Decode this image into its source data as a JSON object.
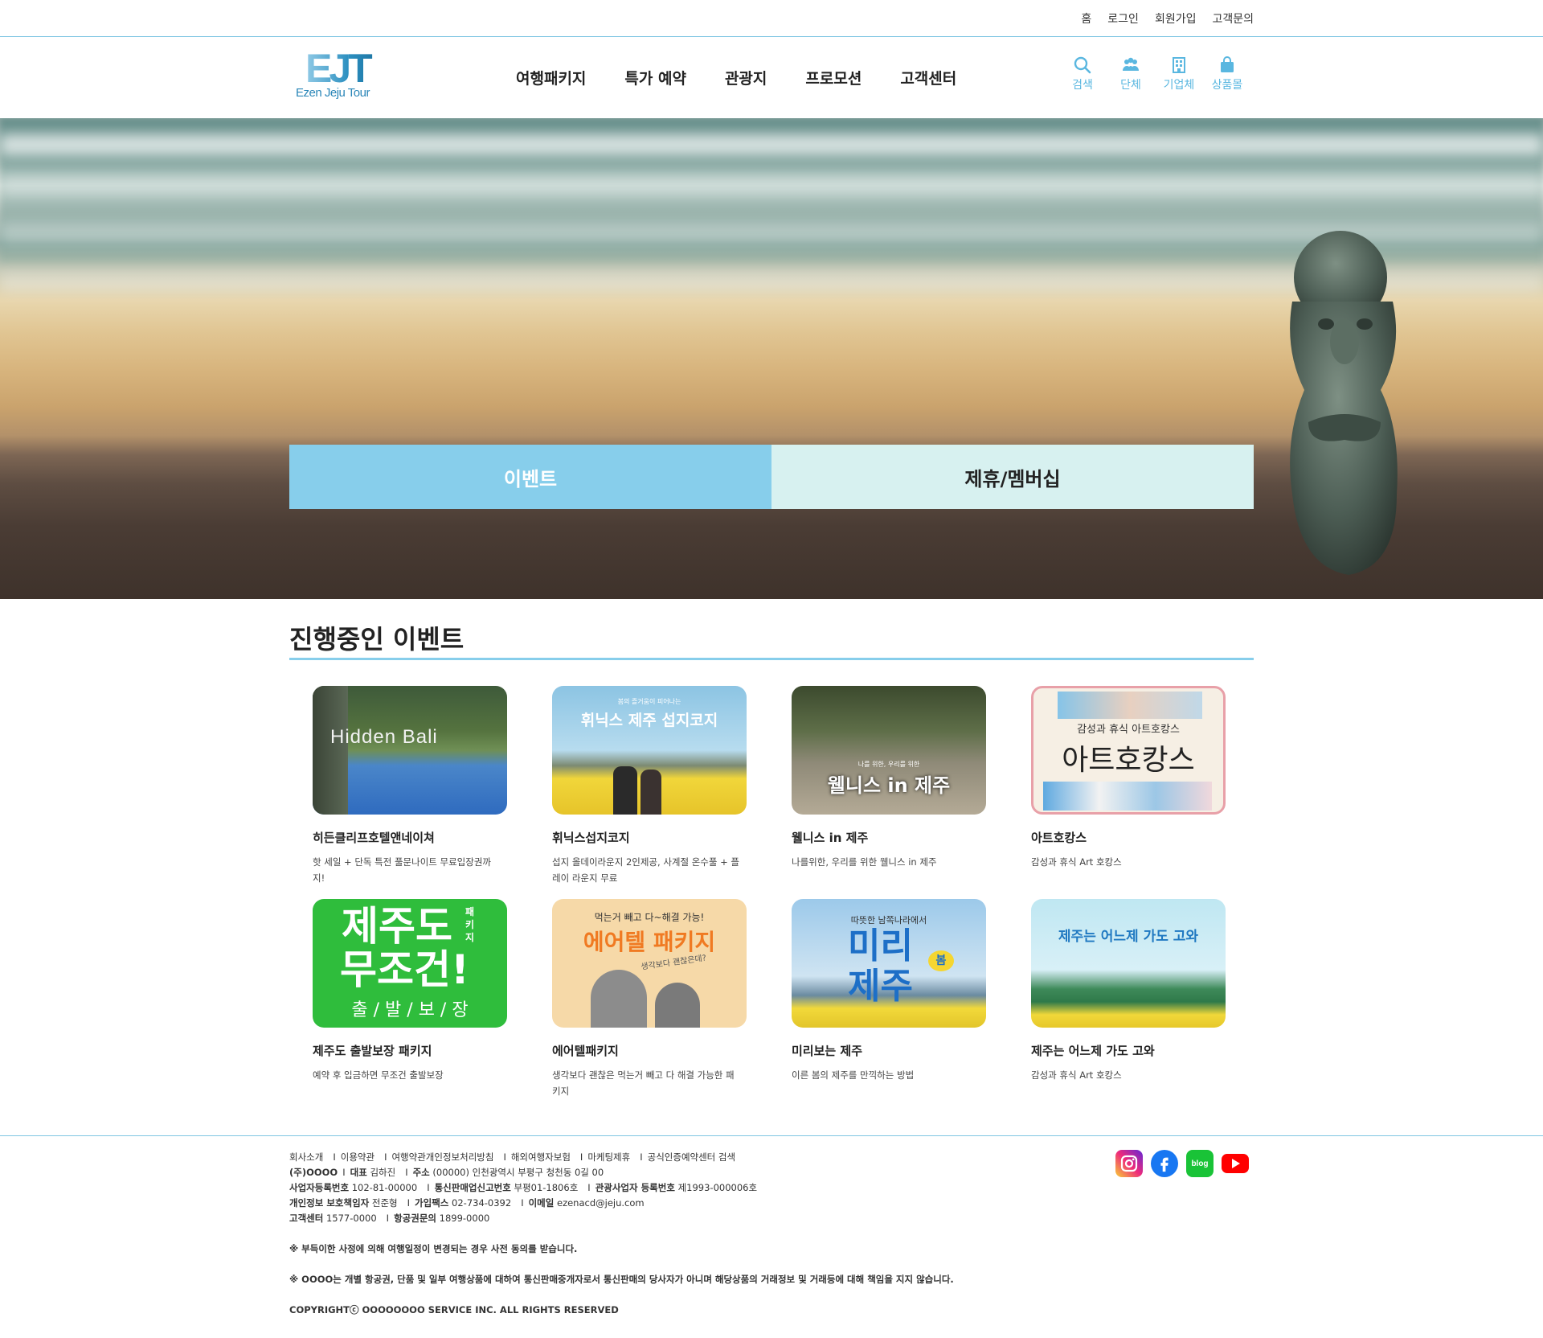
{
  "topbar": {
    "links": [
      "홈",
      "로그인",
      "회원가입",
      "고객문의"
    ]
  },
  "logo": {
    "mark": "EJT",
    "sub": "Ezen Jeju Tour"
  },
  "gnb": [
    "여행패키지",
    "특가 예약",
    "관광지",
    "프로모션",
    "고객센터"
  ],
  "quick": [
    {
      "label": "검색",
      "icon": "search-icon"
    },
    {
      "label": "단체",
      "icon": "group-icon"
    },
    {
      "label": "기업체",
      "icon": "building-icon"
    },
    {
      "label": "상품몰",
      "icon": "shopping-bag-icon"
    }
  ],
  "tabs": {
    "event": "이벤트",
    "membership": "제휴/멤버십"
  },
  "events": {
    "title": "진행중인 이벤트",
    "items": [
      {
        "title": "히든클리프호텔앤네이쳐",
        "desc": "핫 세일 + 단독 특전 풀문나이트 무료입장권까지!",
        "thumb_text": "Hidden Bali"
      },
      {
        "title": "휘닉스섭지코지",
        "desc": "섭지 올데이라운지 2인제공, 사계절 온수풀 + 플레이 라운지 무료",
        "thumb_small": "봄의 즐거움이 피어나는",
        "thumb_text": "휘닉스 제주 섭지코지"
      },
      {
        "title": "웰니스 in 제주",
        "desc": "나를위한, 우리를 위한 웰니스 in 제주",
        "thumb_small": "나를 위한, 우리를 위한",
        "thumb_text": "웰니스 in 제주"
      },
      {
        "title": "아트호캉스",
        "desc": "감성과 휴식 Art 호캉스",
        "thumb_small": "감성과 휴식 아트호캉스",
        "thumb_text": "아트호캉스"
      },
      {
        "title": "제주도 출발보장 패키지",
        "desc": "예약 후 입금하면 무조건 출발보장",
        "thumb_l1": "제주도",
        "thumb_side": "패키지",
        "thumb_l2": "무조건!",
        "thumb_l3": "출 / 발 / 보 / 장"
      },
      {
        "title": "에어텔패키지",
        "desc": "생각보다 괜찮은 먹는거 빼고 다 해결 가능한 패키지",
        "thumb_small": "먹는거 빼고 다~해결 가능!",
        "thumb_text": "에어텔 패키지",
        "thumb_hand": "생각보다 괜찮은데?"
      },
      {
        "title": "미리보는 제주",
        "desc": "이른 봄의 제주를 만끽하는 방법",
        "thumb_small": "따뜻한 남쪽나라에서",
        "thumb_l1": "미리",
        "thumb_badge": "봄",
        "thumb_l2": "제주"
      },
      {
        "title": "제주는 어느제 가도 고와",
        "desc": "감성과 휴식 Art 호캉스",
        "thumb_text": "제주는 어느제 가도 고와"
      }
    ]
  },
  "footer": {
    "links": [
      "회사소개",
      "이용약관",
      "여행약관개인정보처리방침",
      "해외여행자보험",
      "마케팅제휴",
      "공식인증예약센터 검색"
    ],
    "row2": [
      {
        "k": "(주)OOOO",
        "v": ""
      },
      {
        "k": "대표",
        "v": "김하진"
      },
      {
        "k": "주소",
        "v": "(00000) 인천광역시 부평구 청천동 0길 00"
      }
    ],
    "row3": [
      {
        "k": "사업자등록번호",
        "v": "102-81-00000"
      },
      {
        "k": "통신판매업신고번호",
        "v": "부평01-1806호"
      },
      {
        "k": "관광사업자 등록번호",
        "v": "제1993-000006호"
      }
    ],
    "row4": [
      {
        "k": "개인정보 보호책임자",
        "v": "전준형"
      },
      {
        "k": "가입팩스",
        "v": "02-734-0392"
      },
      {
        "k": "이메일",
        "v": "ezenacd@jeju.com"
      }
    ],
    "row5": [
      {
        "k": "고객센터",
        "v": "1577-0000"
      },
      {
        "k": "항공권문의",
        "v": "1899-0000"
      }
    ],
    "notice1": "※ 부득이한 사정에 의해 여행일정이 변경되는 경우 사전 동의를 받습니다.",
    "notice2": "※ OOOO는 개별 항공권, 단품 및 일부 여행상품에 대하여 통신판매중개자로서 통신판매의 당사자가 아니며 해당상품의 거래정보 및 거래등에 대해 책임을 지지 않습니다.",
    "copyright": "COPYRIGHTⓒ OOOOOOOO SERVICE INC. ALL RIGHTS RESERVED"
  },
  "sns": [
    {
      "icon": "instagram-icon",
      "color": "#e1306c"
    },
    {
      "icon": "facebook-icon",
      "color": "#1877f2"
    },
    {
      "icon": "blog-icon",
      "color": "#19c337",
      "label": "blog"
    },
    {
      "icon": "youtube-icon",
      "color": "#ff0000"
    }
  ],
  "colors": {
    "accent": "#87ceeb",
    "tab_inactive": "#d7f1f0",
    "quick_icon": "#5ab7e0"
  }
}
